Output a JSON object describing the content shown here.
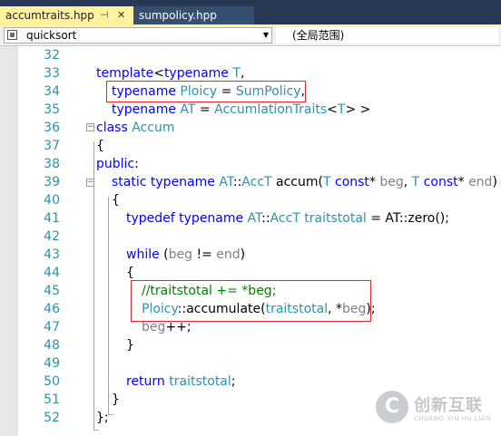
{
  "tabs": [
    {
      "label": "accumtraits.hpp",
      "pin": "⊣",
      "close": "✕"
    },
    {
      "label": "sumpolicy.hpp"
    }
  ],
  "nav": {
    "scope": "quicksort",
    "member": "(全局范围)"
  },
  "line_numbers": [
    "32",
    "33",
    "34",
    "35",
    "36",
    "37",
    "38",
    "39",
    "40",
    "41",
    "42",
    "43",
    "44",
    "45",
    "46",
    "47",
    "48",
    "49",
    "50",
    "51",
    "52"
  ],
  "code": {
    "l33": {
      "t1": "template",
      "t2": "<",
      "t3": "typename",
      "t4": " T",
      ",": ","
    },
    "l34": {
      "t1": "typename",
      "t2": " Ploicy",
      "t3": " = ",
      "t4": "SumPolicy",
      ",": ","
    },
    "l35": {
      "t1": "typename",
      "t2": " AT",
      "t3": " = ",
      "t4": "AccumlationTraits",
      "t5": "<",
      "t6": "T",
      "t7": "> >"
    },
    "l36": {
      "t1": "class",
      "t2": " Accum"
    },
    "l37": {
      "t1": "{"
    },
    "l38": {
      "t1": "public",
      "t2": ":"
    },
    "l39": {
      "t1": "static",
      "t2": " typename",
      "t3": " AT",
      "t4": "::",
      "t5": "AccT",
      "t6": " accum(",
      "t7": "T",
      "t8": " const",
      "t9": "* ",
      "t10": "beg",
      ",": ", ",
      "t11": "T",
      "t12": " const",
      "t13": "* ",
      "t14": "end",
      ")": ")"
    },
    "l40": {
      "t1": "{"
    },
    "l41": {
      "t1": "typedef",
      "t2": " typename",
      "t3": " AT",
      "t4": "::",
      "t5": "AccT",
      "t6": " traitstotal",
      "t7": " = AT::zero();"
    },
    "l43": {
      "t1": "while",
      "t2": " (",
      "t3": "beg",
      "t4": " != ",
      "t5": "end",
      "t6": ")"
    },
    "l44": {
      "t1": "{"
    },
    "l45": {
      "t1": "//traitstotal += *beg;"
    },
    "l46": {
      "t1": "Ploicy",
      "t2": "::accumulate(",
      "t3": "traitstotal",
      ",": ", *",
      "t4": "beg",
      "t5": ");"
    },
    "l47": {
      "t1": "beg",
      "t2": "++;"
    },
    "l48": {
      "t1": "}"
    },
    "l50": {
      "t1": "return",
      "t2": " traitstotal",
      "t3": ";"
    },
    "l51": {
      "t1": "}"
    },
    "l52": {
      "t1": "};"
    }
  },
  "watermark": {
    "logo_char": "C",
    "name_cn": "创新互联",
    "name_en": "CHUANG XIN HU LIAN"
  },
  "colors": {
    "keyword": "#0000ff",
    "type": "#2b91af",
    "comment": "#008000",
    "highlight_box": "#e0262e",
    "active_tab": "#fff29d",
    "tab_strip": "#293955"
  }
}
